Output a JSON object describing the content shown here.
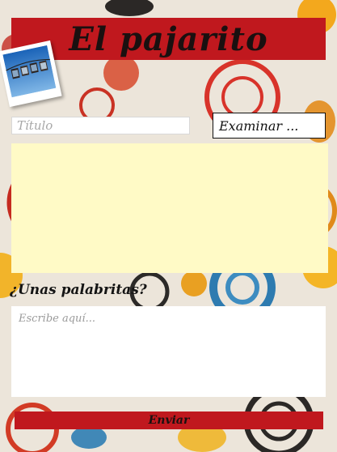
{
  "app": {
    "title": "El pajarito"
  },
  "form": {
    "title_placeholder": "Título",
    "browse_label": "Examinar ...",
    "words_label": "¿Unas palabritas?",
    "message_placeholder": "Escribe aquí...",
    "send_label": "Enviar"
  },
  "colors": {
    "accent_red": "#c0181e",
    "image_area": "#fffac6",
    "background": "#ece5da"
  },
  "icons": {
    "photo": "polaroid-photo-icon"
  }
}
